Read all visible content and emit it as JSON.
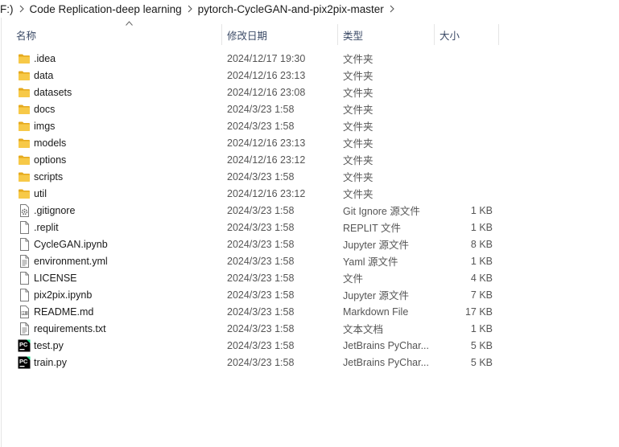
{
  "breadcrumb": [
    "F:)",
    "Code Replication-deep learning",
    "pytorch-CycleGAN-and-pix2pix-master"
  ],
  "columns": {
    "name": "名称",
    "date": "修改日期",
    "type": "类型",
    "size": "大小"
  },
  "files": [
    {
      "name": ".idea",
      "date": "2024/12/17 19:30",
      "type": "文件夹",
      "size": "",
      "icon": "folder-icon"
    },
    {
      "name": "data",
      "date": "2024/12/16 23:13",
      "type": "文件夹",
      "size": "",
      "icon": "folder-icon"
    },
    {
      "name": "datasets",
      "date": "2024/12/16 23:08",
      "type": "文件夹",
      "size": "",
      "icon": "folder-icon"
    },
    {
      "name": "docs",
      "date": "2024/3/23 1:58",
      "type": "文件夹",
      "size": "",
      "icon": "folder-icon"
    },
    {
      "name": "imgs",
      "date": "2024/3/23 1:58",
      "type": "文件夹",
      "size": "",
      "icon": "folder-icon"
    },
    {
      "name": "models",
      "date": "2024/12/16 23:13",
      "type": "文件夹",
      "size": "",
      "icon": "folder-icon"
    },
    {
      "name": "options",
      "date": "2024/12/16 23:12",
      "type": "文件夹",
      "size": "",
      "icon": "folder-icon"
    },
    {
      "name": "scripts",
      "date": "2024/3/23 1:58",
      "type": "文件夹",
      "size": "",
      "icon": "folder-icon"
    },
    {
      "name": "util",
      "date": "2024/12/16 23:12",
      "type": "文件夹",
      "size": "",
      "icon": "folder-icon"
    },
    {
      "name": ".gitignore",
      "date": "2024/3/23 1:58",
      "type": "Git Ignore 源文件",
      "size": "1 KB",
      "icon": "gear-file-icon"
    },
    {
      "name": ".replit",
      "date": "2024/3/23 1:58",
      "type": "REPLIT 文件",
      "size": "1 KB",
      "icon": "blank-file-icon"
    },
    {
      "name": "CycleGAN.ipynb",
      "date": "2024/3/23 1:58",
      "type": "Jupyter 源文件",
      "size": "8 KB",
      "icon": "blank-file-icon"
    },
    {
      "name": "environment.yml",
      "date": "2024/3/23 1:58",
      "type": "Yaml 源文件",
      "size": "1 KB",
      "icon": "text-file-icon"
    },
    {
      "name": "LICENSE",
      "date": "2024/3/23 1:58",
      "type": "文件",
      "size": "4 KB",
      "icon": "blank-file-icon"
    },
    {
      "name": "pix2pix.ipynb",
      "date": "2024/3/23 1:58",
      "type": "Jupyter 源文件",
      "size": "7 KB",
      "icon": "blank-file-icon"
    },
    {
      "name": "README.md",
      "date": "2024/3/23 1:58",
      "type": "Markdown File",
      "size": "17 KB",
      "icon": "markdown-file-icon"
    },
    {
      "name": "requirements.txt",
      "date": "2024/3/23 1:58",
      "type": "文本文档",
      "size": "1 KB",
      "icon": "text-file-icon"
    },
    {
      "name": "test.py",
      "date": "2024/3/23 1:58",
      "type": "JetBrains PyChar...",
      "size": "5 KB",
      "icon": "pycharm-icon"
    },
    {
      "name": "train.py",
      "date": "2024/3/23 1:58",
      "type": "JetBrains PyChar...",
      "size": "5 KB",
      "icon": "pycharm-icon"
    }
  ],
  "colors": {
    "header_text": "#3b4a66",
    "folder": "#f7c948",
    "folder_dark": "#e5a91d",
    "hover": "#e5f3ff"
  }
}
